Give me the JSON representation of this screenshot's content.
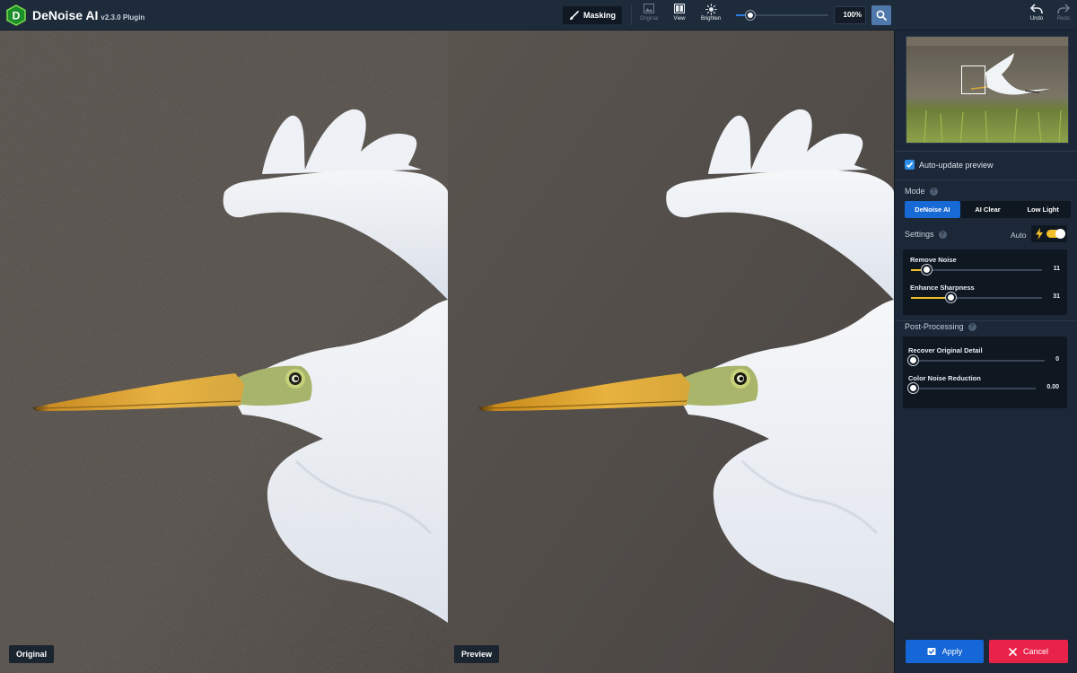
{
  "app": {
    "name": "DeNoise AI",
    "version": "v2.3.0 Plugin"
  },
  "toolbar": {
    "masking_label": "Masking",
    "original_label": "Original",
    "view_label": "View",
    "brighten_label": "Brighten",
    "zoom_value": "100%",
    "undo_label": "Undo",
    "redo_label": "Redo"
  },
  "canvas": {
    "original_label": "Original",
    "preview_label": "Preview"
  },
  "panel": {
    "auto_update_label": "Auto-update preview",
    "auto_update_checked": true,
    "mode_title": "Mode",
    "modes": [
      {
        "label": "DeNoise AI",
        "active": true
      },
      {
        "label": "AI Clear",
        "active": false
      },
      {
        "label": "Low Light",
        "active": false
      }
    ],
    "settings_title": "Settings",
    "auto_label": "Auto",
    "auto_enabled": true,
    "settings_sliders": [
      {
        "label": "Remove Noise",
        "value": "11",
        "fraction": 0.12
      },
      {
        "label": "Enhance Sharpness",
        "value": "31",
        "fraction": 0.31
      }
    ],
    "post_title": "Post-Processing",
    "post_sliders": [
      {
        "label": "Recover Original Detail",
        "value": "0",
        "fraction": 0
      },
      {
        "label": "Color Noise Reduction",
        "value": "0.00",
        "fraction": 0
      }
    ],
    "apply_label": "Apply",
    "cancel_label": "Cancel"
  },
  "colors": {
    "accent": "#1769d6",
    "slider_fill": "#f2bf2a",
    "cancel": "#e9224a",
    "panel_bg": "#1c2838"
  }
}
